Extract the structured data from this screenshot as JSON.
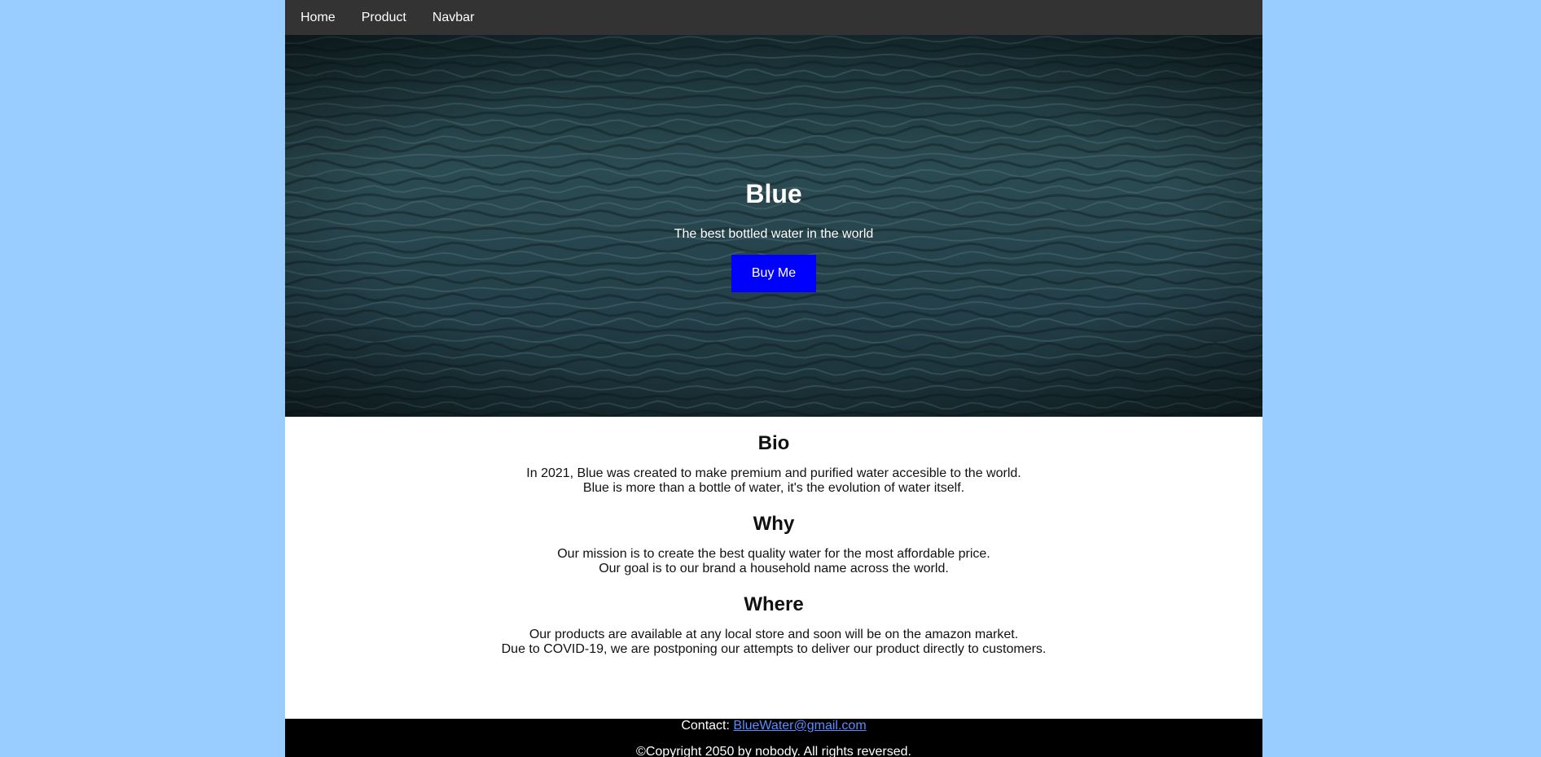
{
  "nav": {
    "items": [
      {
        "label": "Home"
      },
      {
        "label": "Product"
      },
      {
        "label": "Navbar"
      }
    ]
  },
  "hero": {
    "title": "Blue",
    "subtitle": "The best bottled water in the world",
    "button_label": "Buy Me"
  },
  "sections": [
    {
      "heading": "Bio",
      "lines": [
        "In 2021, Blue was created to make premium and purified water accesible to the world.",
        "Blue is more than a bottle of water, it's the evolution of water itself."
      ]
    },
    {
      "heading": "Why",
      "lines": [
        "Our mission is to create the best quality water for the most affordable price.",
        "Our goal is to our brand a household name across the world."
      ]
    },
    {
      "heading": "Where",
      "lines": [
        "Our products are available at any local store and soon will be on the amazon market.",
        "Due to COVID-19, we are postponing our attempts to deliver our product directly to customers."
      ]
    }
  ],
  "footer": {
    "contact_label": "Contact:",
    "email": "BlueWater@gmail.com",
    "copyright": "©Copyright 2050 by nobody. All rights reversed."
  },
  "colors": {
    "page_background": "#99ccff",
    "navbar": "#333333",
    "button": "#0000ff",
    "footer": "#000000",
    "link": "#5a8dff"
  }
}
